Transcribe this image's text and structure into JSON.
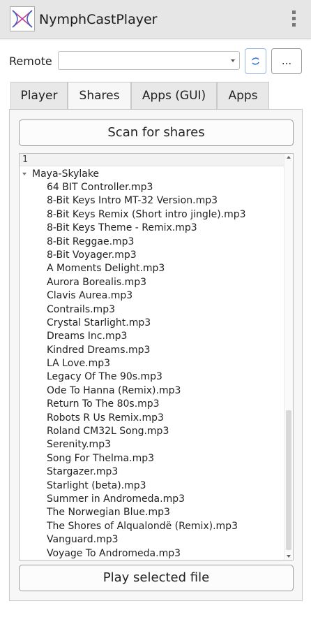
{
  "app": {
    "title": "NymphCastPlayer",
    "logo_icon": "nymphcast-logo-icon",
    "menu_icon": "kebab-menu-icon"
  },
  "remote": {
    "label": "Remote",
    "selected": "",
    "refresh_icon": "refresh-icon",
    "more_label": "..."
  },
  "tabs": [
    {
      "label": "Player",
      "active": false
    },
    {
      "label": "Shares",
      "active": true
    },
    {
      "label": "Apps (GUI)",
      "active": false
    },
    {
      "label": "Apps",
      "active": false
    }
  ],
  "shares": {
    "scan_label": "Scan for shares",
    "tree_header": "1",
    "folder": "Maya-Skylake",
    "files": [
      "64 BIT Controller.mp3",
      "8-Bit Keys Intro MT-32 Version.mp3",
      "8-Bit Keys Remix (Short intro jingle).mp3",
      "8-Bit Keys Theme - Remix.mp3",
      "8-Bit Reggae.mp3",
      "8-Bit Voyager.mp3",
      "A Moments Delight.mp3",
      "Aurora Borealis.mp3",
      "Clavis Aurea.mp3",
      "Contrails.mp3",
      "Crystal Starlight.mp3",
      "Dreams Inc.mp3",
      "Kindred Dreams.mp3",
      "LA Love.mp3",
      "Legacy Of The 90s.mp3",
      "Ode To Hanna (Remix).mp3",
      "Return To The 80s.mp3",
      "Robots R Us Remix.mp3",
      "Roland CM32L Song.mp3",
      "Serenity.mp3",
      "Song For Thelma.mp3",
      "Stargazer.mp3",
      "Starlight (beta).mp3",
      "Summer in Andromeda.mp3",
      "The Norwegian Blue.mp3",
      "The Shores of Alqualondë (Remix).mp3",
      "Vanguard.mp3",
      "Voyage To Andromeda.mp3"
    ],
    "play_label": "Play selected file"
  },
  "colors": {
    "accent": "#2a6fdb",
    "titlebar_bg": "#e6e6e6",
    "logo_pink": "#c23a8c",
    "logo_blue": "#3a5fc2"
  }
}
